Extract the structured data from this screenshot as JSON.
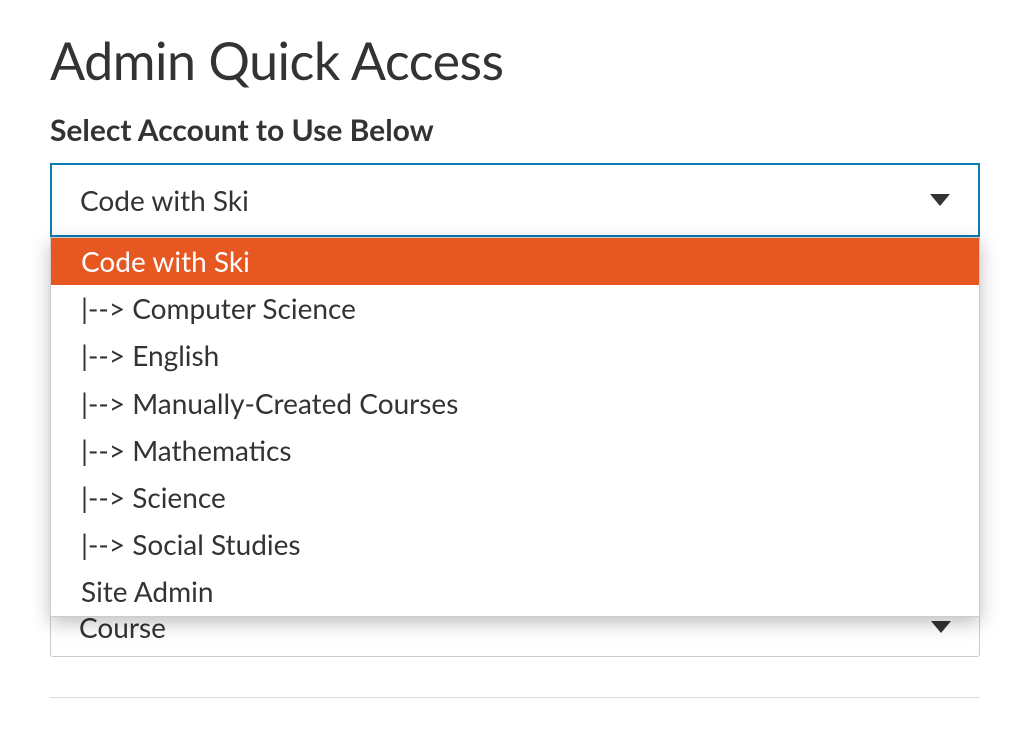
{
  "title": "Admin Quick Access",
  "section_label": "Select Account to Use Below",
  "account_select": {
    "value": "Code with Ski",
    "options": [
      {
        "label": "Code with Ski",
        "indented": false,
        "selected": true
      },
      {
        "label": "|--> Computer Science",
        "indented": true,
        "selected": false
      },
      {
        "label": "|--> English",
        "indented": true,
        "selected": false
      },
      {
        "label": "|--> Manually-Created Courses",
        "indented": true,
        "selected": false
      },
      {
        "label": "|--> Mathematics",
        "indented": true,
        "selected": false
      },
      {
        "label": "|--> Science",
        "indented": true,
        "selected": false
      },
      {
        "label": "|--> Social Studies",
        "indented": true,
        "selected": false
      },
      {
        "label": "Site Admin",
        "indented": false,
        "selected": false
      }
    ]
  },
  "second_select": {
    "value": "Course"
  }
}
